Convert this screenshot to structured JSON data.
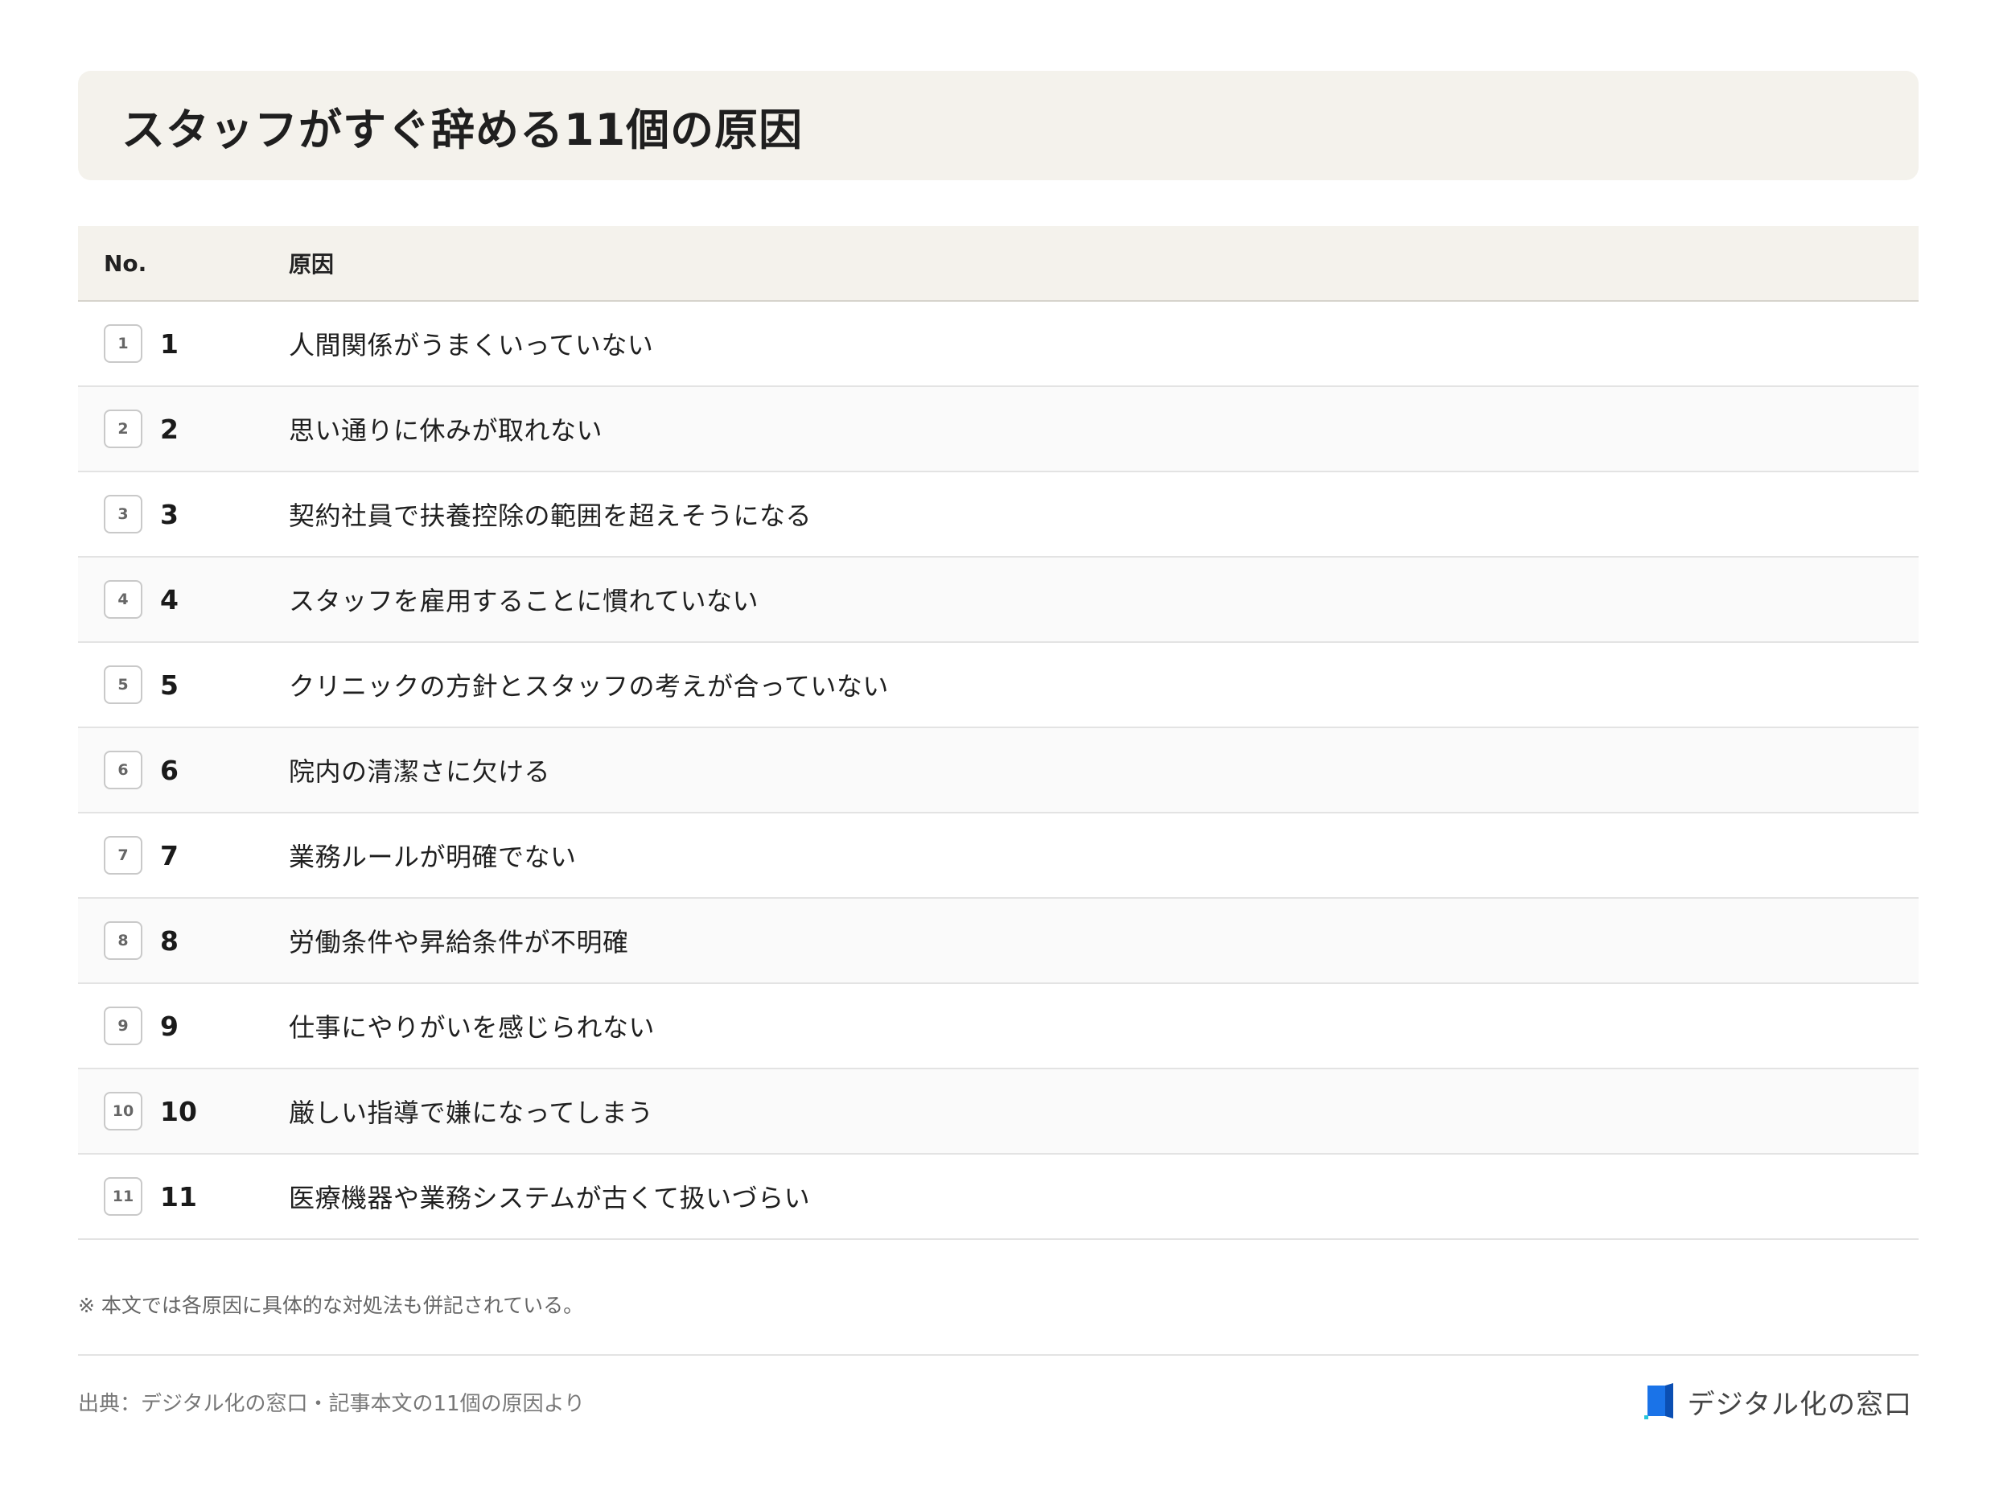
{
  "title": "スタッフがすぐ辞める11個の原因",
  "table": {
    "headers": {
      "no": "No.",
      "cause": "原因"
    },
    "rows": [
      {
        "badge": "1",
        "no": "1",
        "cause": "人間関係がうまくいっていない"
      },
      {
        "badge": "2",
        "no": "2",
        "cause": "思い通りに休みが取れない"
      },
      {
        "badge": "3",
        "no": "3",
        "cause": "契約社員で扶養控除の範囲を超えそうになる"
      },
      {
        "badge": "4",
        "no": "4",
        "cause": "スタッフを雇用することに慣れていない"
      },
      {
        "badge": "5",
        "no": "5",
        "cause": "クリニックの方針とスタッフの考えが合っていない"
      },
      {
        "badge": "6",
        "no": "6",
        "cause": "院内の清潔さに欠ける"
      },
      {
        "badge": "7",
        "no": "7",
        "cause": "業務ルールが明確でない"
      },
      {
        "badge": "8",
        "no": "8",
        "cause": "労働条件や昇給条件が不明確"
      },
      {
        "badge": "9",
        "no": "9",
        "cause": "仕事にやりがいを感じられない"
      },
      {
        "badge": "10",
        "no": "10",
        "cause": "厳しい指導で嫌になってしまう"
      },
      {
        "badge": "11",
        "no": "11",
        "cause": "医療機器や業務システムが古くて扱いづらい"
      }
    ]
  },
  "note": "※ 本文では各原因に具体的な対処法も併記されている。",
  "footer": {
    "source": "出典：デジタル化の窓口・記事本文の11個の原因より",
    "brand": "デジタル化の窓口",
    "brand_icon": "door-logo-icon",
    "brand_color": "#1a73e8"
  }
}
